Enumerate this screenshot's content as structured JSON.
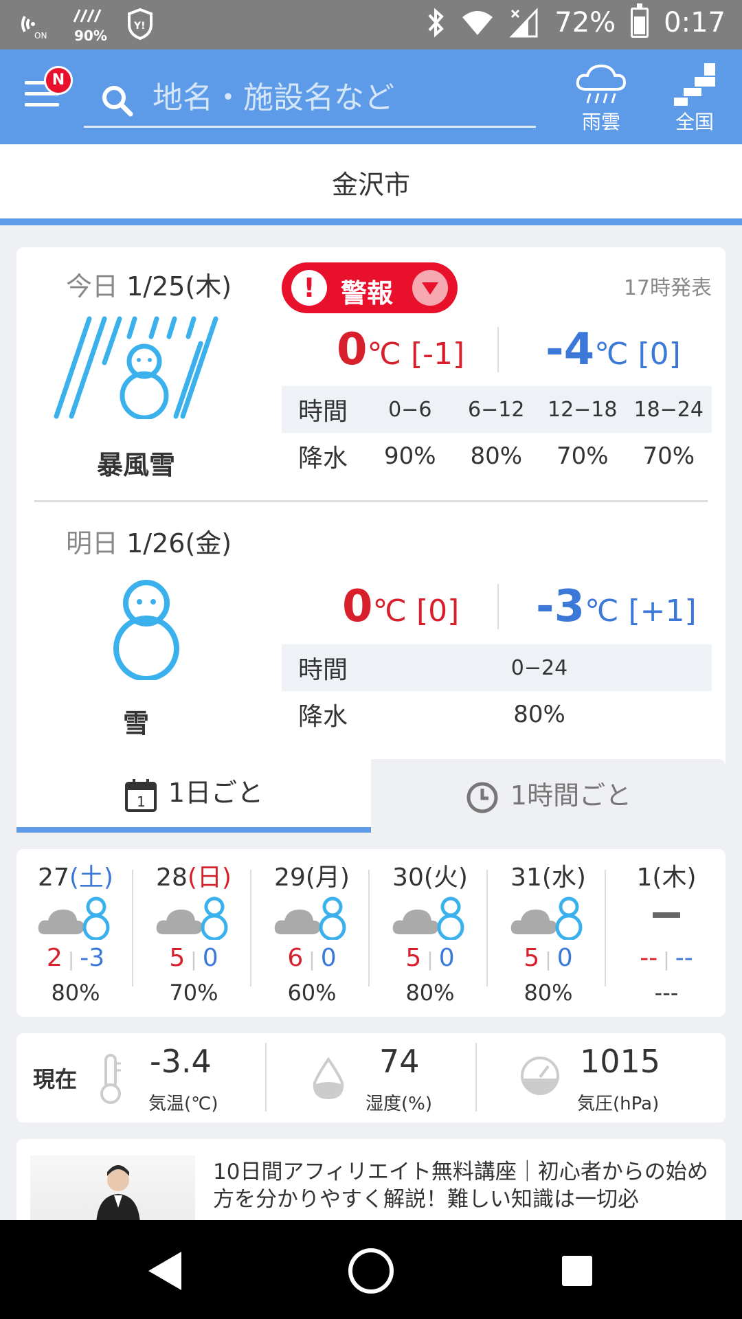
{
  "status_bar": {
    "battery_percent": "72%",
    "time": "0:17",
    "precip_indicator": "90%",
    "icons": [
      "nfc-on-icon",
      "rain-indicator-icon",
      "yahoo-shield-icon",
      "bluetooth-icon",
      "wifi-icon",
      "cellular-signal-icon",
      "battery-icon"
    ]
  },
  "app_bar": {
    "badge": "N",
    "search_placeholder": "地名・施設名など",
    "rain_cloud_label": "雨雲",
    "nationwide_label": "全国"
  },
  "location": {
    "name": "金沢市"
  },
  "today": {
    "day": "今日",
    "date": "1/25(木)",
    "alert_label": "警報",
    "alert_mark": "!",
    "issued": "17時発表",
    "weather": "暴風雪",
    "high": "0",
    "high_unit": "℃",
    "high_diff": "[-1]",
    "low": "-4",
    "low_unit": "℃",
    "low_diff": "[0]",
    "time_label": "時間",
    "precip_label": "降水",
    "periods": [
      "0−6",
      "6−12",
      "12−18",
      "18−24"
    ],
    "precip": [
      "90%",
      "80%",
      "70%",
      "70%"
    ]
  },
  "tomorrow": {
    "day": "明日",
    "date": "1/26(金)",
    "weather": "雪",
    "high": "0",
    "high_unit": "℃",
    "high_diff": "[0]",
    "low": "-3",
    "low_unit": "℃",
    "low_diff": "[+1]",
    "time_label": "時間",
    "precip_label": "降水",
    "period": "0−24",
    "precip": "80%"
  },
  "tabs": {
    "daily": "1日ごと",
    "hourly": "1時間ごと",
    "calendar_day": "1"
  },
  "week": [
    {
      "day": "27",
      "dow": "(土)",
      "dow_color": "#3b78d8",
      "high": "2",
      "low": "-3",
      "precip": "80%",
      "icon": "cloud-snow-icon"
    },
    {
      "day": "28",
      "dow": "(日)",
      "dow_color": "#d8202c",
      "high": "5",
      "low": "0",
      "precip": "70%",
      "icon": "cloud-snow-icon"
    },
    {
      "day": "29",
      "dow": "(月)",
      "dow_color": "#333333",
      "high": "6",
      "low": "0",
      "precip": "60%",
      "icon": "cloud-snow-icon"
    },
    {
      "day": "30",
      "dow": "(火)",
      "dow_color": "#333333",
      "high": "5",
      "low": "0",
      "precip": "80%",
      "icon": "cloud-snow-icon"
    },
    {
      "day": "31",
      "dow": "(水)",
      "dow_color": "#333333",
      "high": "5",
      "low": "0",
      "precip": "80%",
      "icon": "cloud-snow-icon"
    },
    {
      "day": "1",
      "dow": "(木)",
      "dow_color": "#333333",
      "high": "--",
      "low": "--",
      "precip": "---",
      "icon": "no-data-dash-icon"
    }
  ],
  "current": {
    "label": "現在",
    "temperature": "-3.4",
    "temperature_unit": "気温(℃)",
    "humidity": "74",
    "humidity_unit": "湿度(%)",
    "pressure": "1015",
    "pressure_unit": "気圧(hPa)"
  },
  "ad": {
    "text": "10日間アフィリエイト無料講座｜初心者からの始め方を分かりやすく解説！難しい知識は一切必"
  },
  "colors": {
    "accent": "#5d9be8",
    "alert": "#e8102a",
    "high_temp": "#d8202c",
    "low_temp": "#3b78d8",
    "snow_icon": "#3ab0ec"
  }
}
